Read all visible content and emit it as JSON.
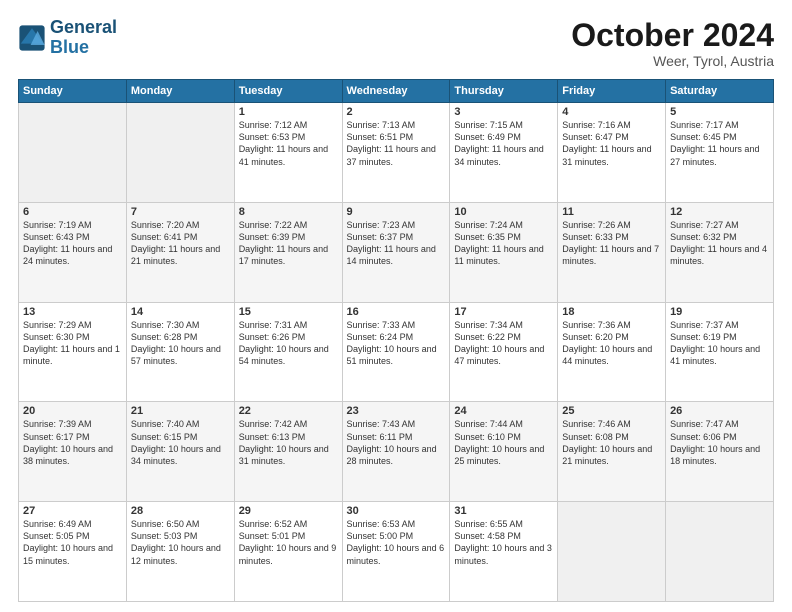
{
  "header": {
    "logo_general": "General",
    "logo_blue": "Blue",
    "month": "October 2024",
    "location": "Weer, Tyrol, Austria"
  },
  "weekdays": [
    "Sunday",
    "Monday",
    "Tuesday",
    "Wednesday",
    "Thursday",
    "Friday",
    "Saturday"
  ],
  "weeks": [
    [
      {
        "day": "",
        "text": ""
      },
      {
        "day": "",
        "text": ""
      },
      {
        "day": "1",
        "text": "Sunrise: 7:12 AM\nSunset: 6:53 PM\nDaylight: 11 hours and 41 minutes."
      },
      {
        "day": "2",
        "text": "Sunrise: 7:13 AM\nSunset: 6:51 PM\nDaylight: 11 hours and 37 minutes."
      },
      {
        "day": "3",
        "text": "Sunrise: 7:15 AM\nSunset: 6:49 PM\nDaylight: 11 hours and 34 minutes."
      },
      {
        "day": "4",
        "text": "Sunrise: 7:16 AM\nSunset: 6:47 PM\nDaylight: 11 hours and 31 minutes."
      },
      {
        "day": "5",
        "text": "Sunrise: 7:17 AM\nSunset: 6:45 PM\nDaylight: 11 hours and 27 minutes."
      }
    ],
    [
      {
        "day": "6",
        "text": "Sunrise: 7:19 AM\nSunset: 6:43 PM\nDaylight: 11 hours and 24 minutes."
      },
      {
        "day": "7",
        "text": "Sunrise: 7:20 AM\nSunset: 6:41 PM\nDaylight: 11 hours and 21 minutes."
      },
      {
        "day": "8",
        "text": "Sunrise: 7:22 AM\nSunset: 6:39 PM\nDaylight: 11 hours and 17 minutes."
      },
      {
        "day": "9",
        "text": "Sunrise: 7:23 AM\nSunset: 6:37 PM\nDaylight: 11 hours and 14 minutes."
      },
      {
        "day": "10",
        "text": "Sunrise: 7:24 AM\nSunset: 6:35 PM\nDaylight: 11 hours and 11 minutes."
      },
      {
        "day": "11",
        "text": "Sunrise: 7:26 AM\nSunset: 6:33 PM\nDaylight: 11 hours and 7 minutes."
      },
      {
        "day": "12",
        "text": "Sunrise: 7:27 AM\nSunset: 6:32 PM\nDaylight: 11 hours and 4 minutes."
      }
    ],
    [
      {
        "day": "13",
        "text": "Sunrise: 7:29 AM\nSunset: 6:30 PM\nDaylight: 11 hours and 1 minute."
      },
      {
        "day": "14",
        "text": "Sunrise: 7:30 AM\nSunset: 6:28 PM\nDaylight: 10 hours and 57 minutes."
      },
      {
        "day": "15",
        "text": "Sunrise: 7:31 AM\nSunset: 6:26 PM\nDaylight: 10 hours and 54 minutes."
      },
      {
        "day": "16",
        "text": "Sunrise: 7:33 AM\nSunset: 6:24 PM\nDaylight: 10 hours and 51 minutes."
      },
      {
        "day": "17",
        "text": "Sunrise: 7:34 AM\nSunset: 6:22 PM\nDaylight: 10 hours and 47 minutes."
      },
      {
        "day": "18",
        "text": "Sunrise: 7:36 AM\nSunset: 6:20 PM\nDaylight: 10 hours and 44 minutes."
      },
      {
        "day": "19",
        "text": "Sunrise: 7:37 AM\nSunset: 6:19 PM\nDaylight: 10 hours and 41 minutes."
      }
    ],
    [
      {
        "day": "20",
        "text": "Sunrise: 7:39 AM\nSunset: 6:17 PM\nDaylight: 10 hours and 38 minutes."
      },
      {
        "day": "21",
        "text": "Sunrise: 7:40 AM\nSunset: 6:15 PM\nDaylight: 10 hours and 34 minutes."
      },
      {
        "day": "22",
        "text": "Sunrise: 7:42 AM\nSunset: 6:13 PM\nDaylight: 10 hours and 31 minutes."
      },
      {
        "day": "23",
        "text": "Sunrise: 7:43 AM\nSunset: 6:11 PM\nDaylight: 10 hours and 28 minutes."
      },
      {
        "day": "24",
        "text": "Sunrise: 7:44 AM\nSunset: 6:10 PM\nDaylight: 10 hours and 25 minutes."
      },
      {
        "day": "25",
        "text": "Sunrise: 7:46 AM\nSunset: 6:08 PM\nDaylight: 10 hours and 21 minutes."
      },
      {
        "day": "26",
        "text": "Sunrise: 7:47 AM\nSunset: 6:06 PM\nDaylight: 10 hours and 18 minutes."
      }
    ],
    [
      {
        "day": "27",
        "text": "Sunrise: 6:49 AM\nSunset: 5:05 PM\nDaylight: 10 hours and 15 minutes."
      },
      {
        "day": "28",
        "text": "Sunrise: 6:50 AM\nSunset: 5:03 PM\nDaylight: 10 hours and 12 minutes."
      },
      {
        "day": "29",
        "text": "Sunrise: 6:52 AM\nSunset: 5:01 PM\nDaylight: 10 hours and 9 minutes."
      },
      {
        "day": "30",
        "text": "Sunrise: 6:53 AM\nSunset: 5:00 PM\nDaylight: 10 hours and 6 minutes."
      },
      {
        "day": "31",
        "text": "Sunrise: 6:55 AM\nSunset: 4:58 PM\nDaylight: 10 hours and 3 minutes."
      },
      {
        "day": "",
        "text": ""
      },
      {
        "day": "",
        "text": ""
      }
    ]
  ]
}
